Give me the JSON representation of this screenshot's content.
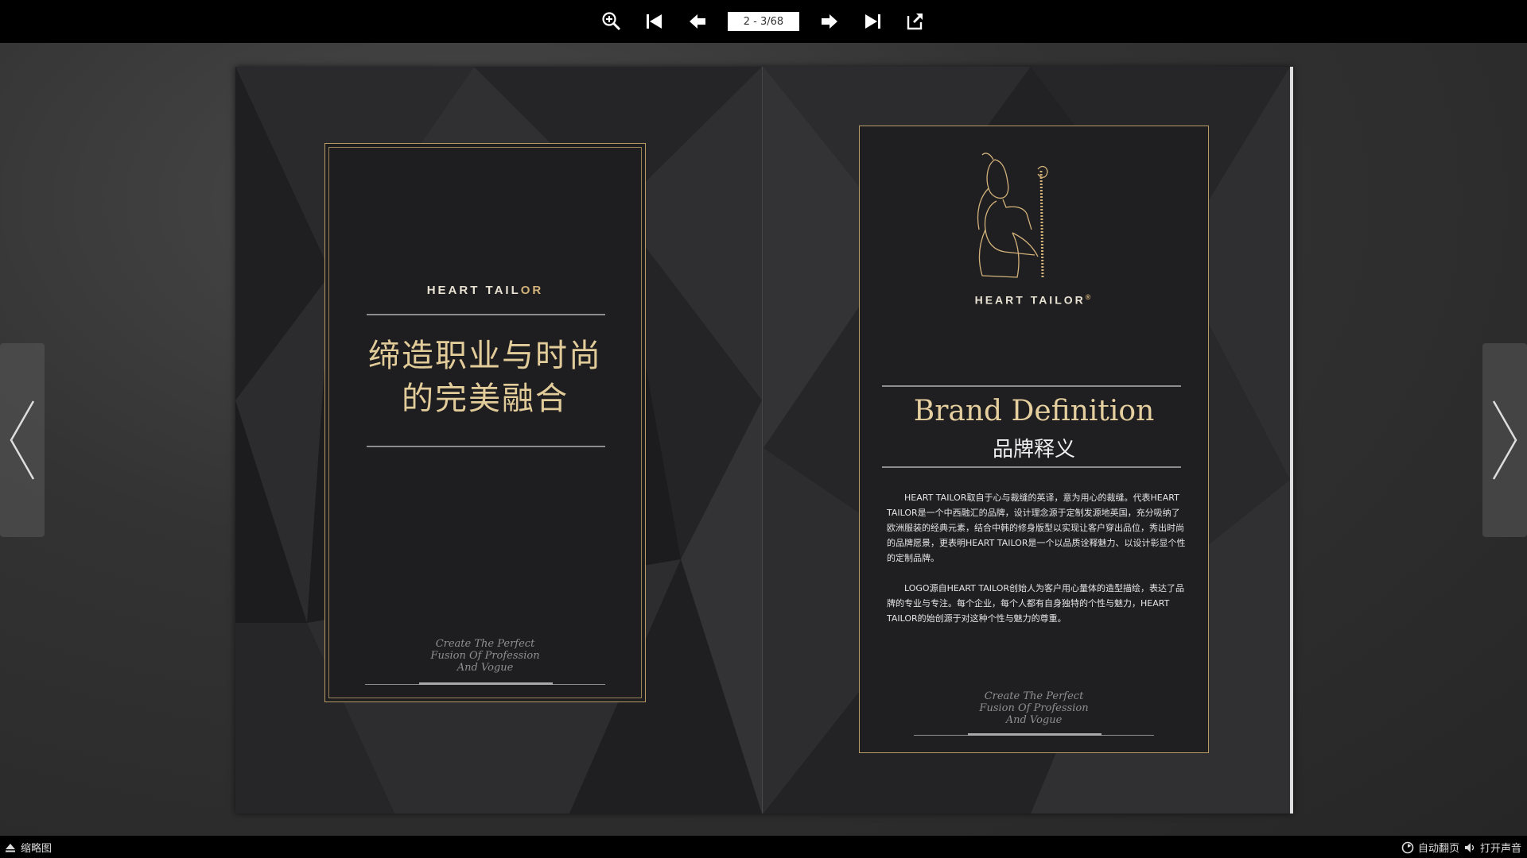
{
  "toolbar": {
    "page_indicator": "2 - 3/68",
    "icons": [
      "zoom-in-icon",
      "first-page-icon",
      "prev-page-icon",
      "next-page-icon",
      "last-page-icon",
      "exit-fullscreen-icon"
    ]
  },
  "left_page": {
    "brand_part1": "HEART TAIL",
    "brand_part2": "OR",
    "title_line1": "缔造职业与时尚",
    "title_line2": "的完美融合",
    "slogan_line1": "Create The Perfect",
    "slogan_line2": "Fusion Of Profession",
    "slogan_line3": "And Vogue"
  },
  "right_page": {
    "logo_brand": "HEART TAILOR",
    "logo_mark": "®",
    "heading_en": "Brand Definition",
    "heading_cn": "品牌释义",
    "paragraph1": "HEART TAILOR取自于心与裁缝的英译，意为用心的裁缝。代表HEART TAILOR是一个中西融汇的品牌，设计理念源于定制发源地英国，充分吸纳了欧洲服装的经典元素，结合中韩的修身版型以实现让客户穿出品位，秀出时尚的品牌愿景，更表明HEART TAILOR是一个以品质诠释魅力、以设计彰显个性的定制品牌。",
    "paragraph2": "LOGO源自HEART TAILOR创始人为客户用心量体的造型描绘，表达了品牌的专业与专注。每个企业，每个人都有自身独特的个性与魅力，HEART TAILOR的始创源于对这种个性与魅力的尊重。",
    "slogan_line1": "Create The Perfect",
    "slogan_line2": "Fusion Of Profession",
    "slogan_line3": "And Vogue"
  },
  "bottombar": {
    "thumbnails_label": "缩略图",
    "auto_flip_label": "自动翻页",
    "sound_label": "打开声音"
  },
  "colors": {
    "gold": "#d3b37a",
    "toolbar_bg": "#000000",
    "page_bg": "#1c1c1e"
  }
}
